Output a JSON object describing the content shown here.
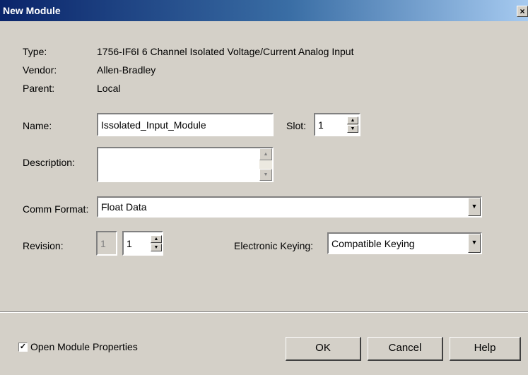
{
  "window": {
    "title": "New Module",
    "close_glyph": "×"
  },
  "fields": {
    "type_label": "Type:",
    "type_value": "1756-IF6I 6 Channel Isolated Voltage/Current Analog Input",
    "vendor_label": "Vendor:",
    "vendor_value": "Allen-Bradley",
    "parent_label": "Parent:",
    "parent_value": "Local",
    "name_label": "Name:",
    "name_value": "Issolated_Input_Module",
    "slot_label": "Slot:",
    "slot_value": "1",
    "description_label": "Description:",
    "description_value": "",
    "comm_format_label": "Comm Format:",
    "comm_format_value": "Float Data",
    "revision_label": "Revision:",
    "revision_major": "1",
    "revision_minor": "1",
    "keying_label": "Electronic Keying:",
    "keying_value": "Compatible Keying"
  },
  "footer": {
    "open_props_label": "Open Module Properties",
    "open_props_checked": true,
    "ok_label": "OK",
    "cancel_label": "Cancel",
    "help_label": "Help"
  },
  "colors": {
    "titlebar_start": "#0a246a",
    "titlebar_end": "#a6caf0",
    "dialog_bg": "#d4d0c8"
  },
  "icons": {
    "check": "check-mark-icon",
    "up": "up-arrow-icon",
    "down": "down-arrow-icon",
    "dropdown": "dropdown-arrow-icon"
  }
}
